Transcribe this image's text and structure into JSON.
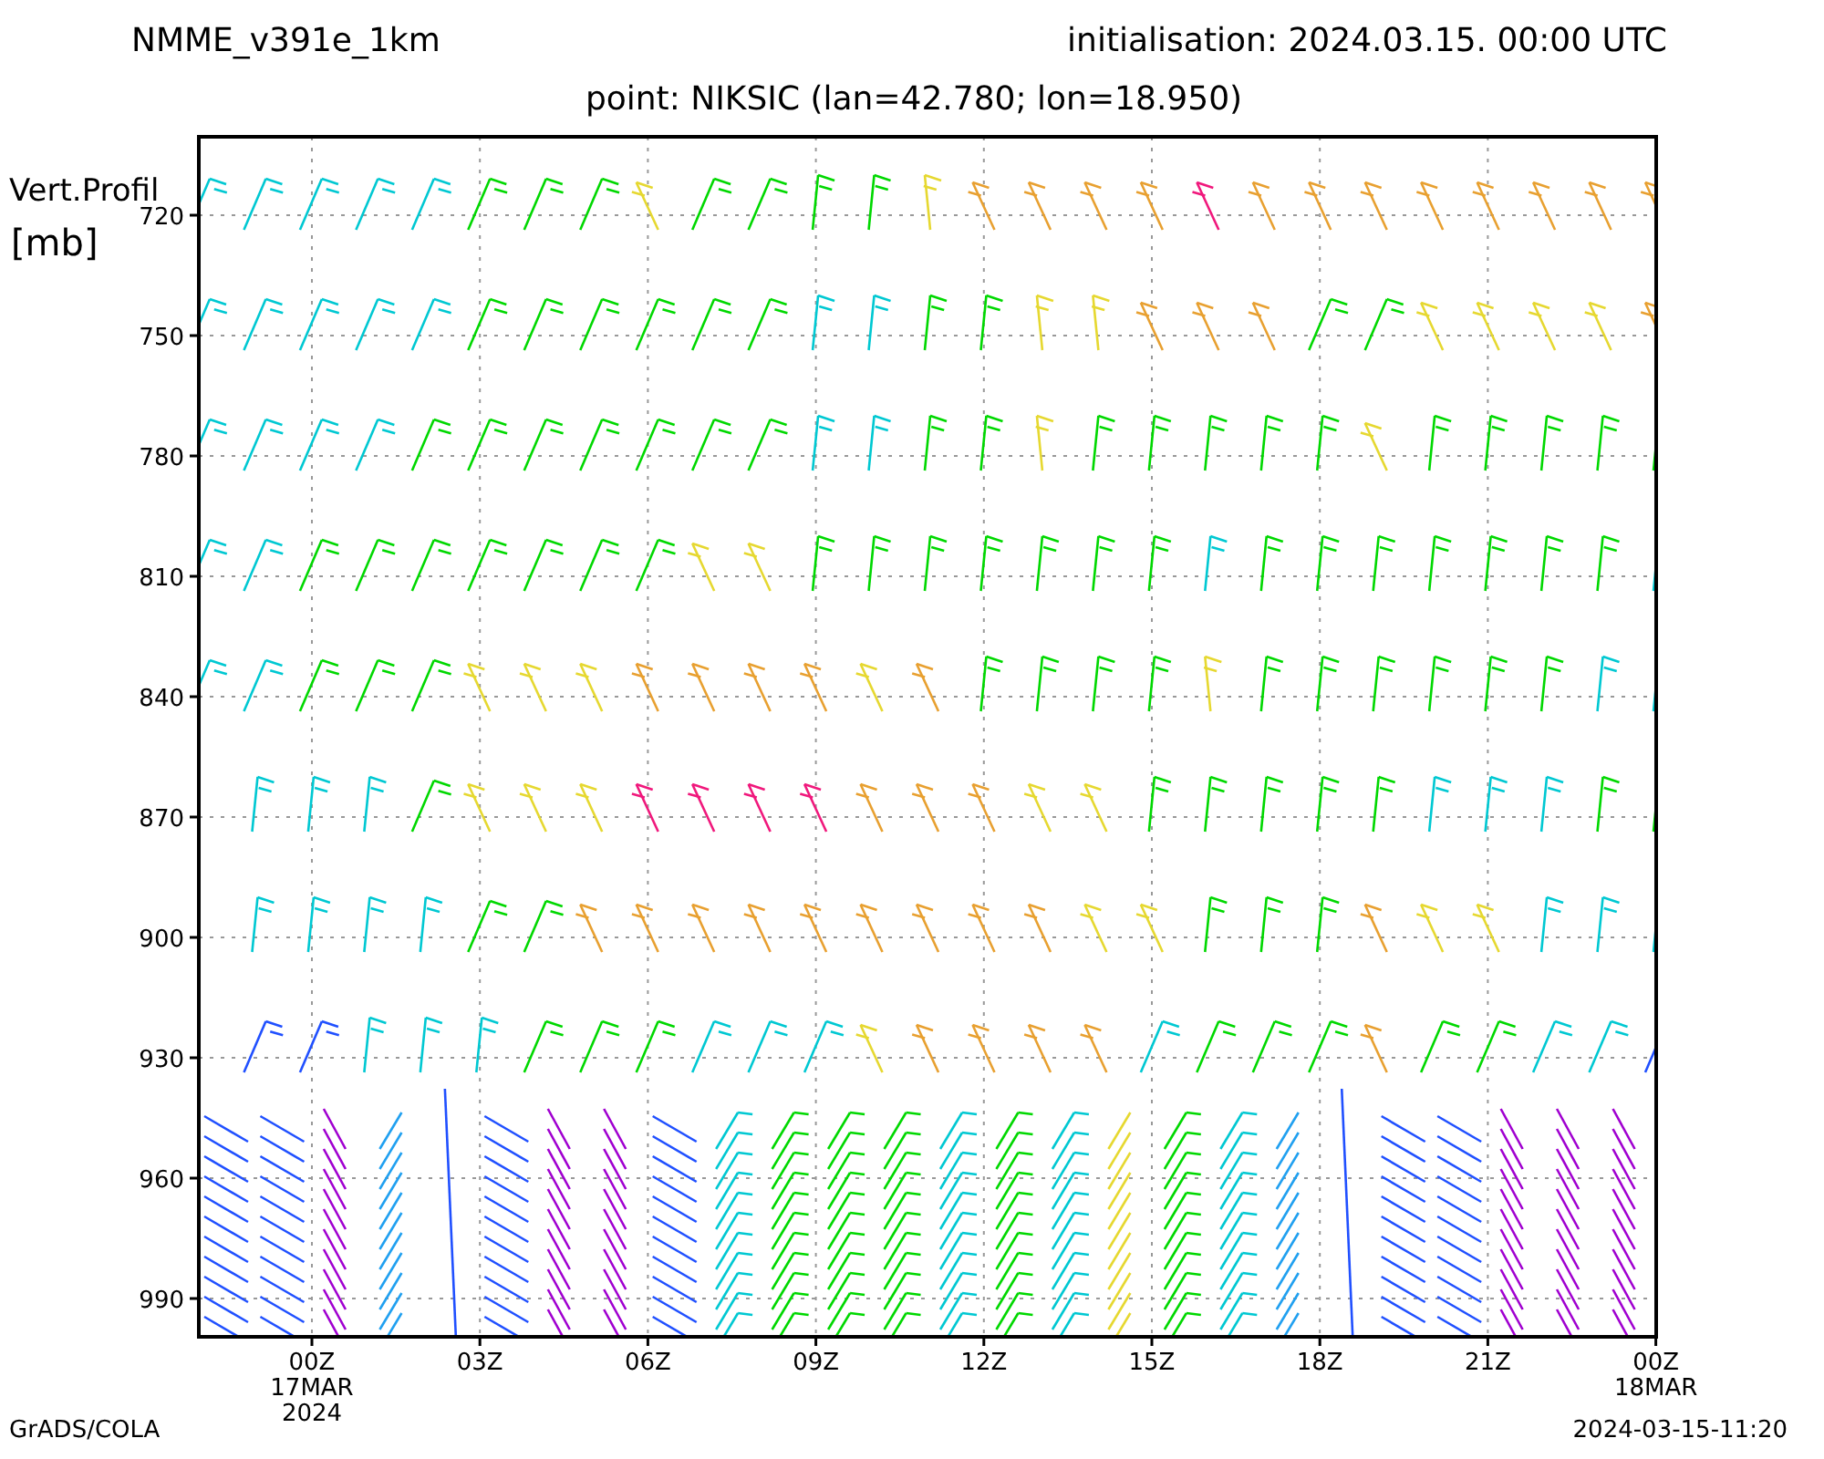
{
  "header": {
    "model": "NMME_v391e_1km",
    "initialisation": "initialisation: 2024.03.15. 00:00 UTC"
  },
  "subtitle": "point: NIKSIC (lan=42.780; lon=18.950)",
  "y_axis": {
    "title": "Vert.Profil",
    "unit": "[mb]",
    "ticks": [
      "720",
      "750",
      "780",
      "810",
      "840",
      "870",
      "900",
      "930",
      "960",
      "990"
    ]
  },
  "x_axis": {
    "ticks": [
      {
        "label": "00Z",
        "date": "17MAR",
        "year": "2024"
      },
      {
        "label": "03Z"
      },
      {
        "label": "06Z"
      },
      {
        "label": "09Z"
      },
      {
        "label": "12Z"
      },
      {
        "label": "15Z"
      },
      {
        "label": "18Z"
      },
      {
        "label": "21Z"
      },
      {
        "label": "00Z",
        "date": "18MAR"
      }
    ]
  },
  "footer": {
    "left": "GrADS/COLA",
    "right": "2024-03-15-11:20"
  }
}
